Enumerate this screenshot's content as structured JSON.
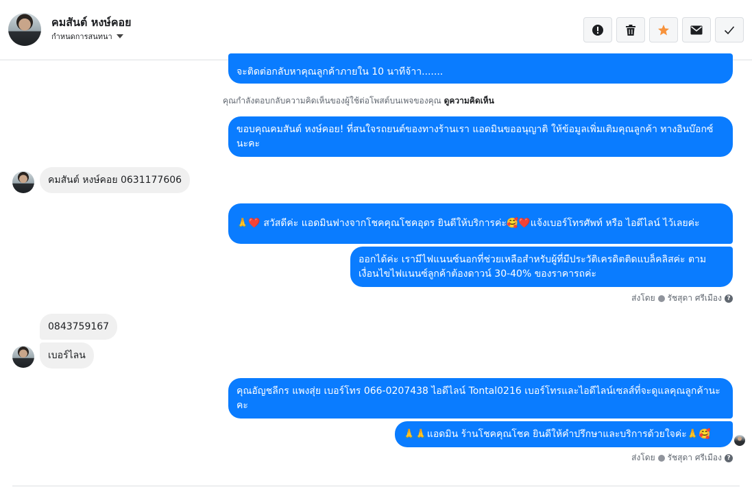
{
  "header": {
    "contact_name": "คมสันต์ หงษ์คอย",
    "assign_label": "กำหนดการสนทนา",
    "actions": {
      "spam": "exclamation-icon",
      "delete": "trash-icon",
      "star": "star-icon",
      "mark_unread": "envelope-icon",
      "done": "check-icon"
    },
    "star_color": "#f7923b"
  },
  "messages": {
    "m1": "จะติดต่อกลับหาคุณลูกค้าภายใน 10 นาทีจ้าา.......",
    "comment_notice": "คุณกำลังตอบกลับความคิดเห็นของผู้ใช้ต่อโพสต์บนเพจของคุณ",
    "comment_link": "ดูความคิดเห็น",
    "m2": "ขอบคุณคมสันต์ หงษ์คอย! ที่สนใจรถยนต์ของทางร้านเรา แอดมินขออนุญาติ ให้ข้อมูลเพิ่มเติมคุณลูกค้า ทางอินบ๊อกซ์นะคะ",
    "m3": "คมสันต์ หงษ์คอย 0631177606",
    "m4": "🙏❤️ สวัสดีค่ะ แอดมินฟางจากโชคคุณโชคอุดร ยินดีให้บริการค่ะ🥰❤️แจ้งเบอร์โทรศัพท์ หรือ ไอดีไลน์  ไว้เลยค่ะ",
    "m5": "ออกได้ค่ะ เรามีไฟแนนซ์นอกที่ช่วยเหลือสำหรับผู้ที่มีประวัติเครดิตติดแบล็คลิสค่ะ ตามเงื่อนไขไฟแนนซ์ลูกค้าต้องดาวน์ 30-40% ของราคารถค่ะ",
    "sent_by_1": "ส่งโดย",
    "sender_1": "รัชสุดา ศรีเมือง",
    "m6": "0843759167",
    "m7": "เบอร์ไลน",
    "m8": "คุณอัญชลีกร แพงสุ่ย      เบอร์โทร 066-0207438 ไอดีไลน์ Tontal0216   เบอร์โทรและไอดีไลน์เซลส์ที่จะดูแลคุณลูกค้านะคะ",
    "m9": "🙏🙏แอดมิน ร้านโชคคุณโชค ยินดีให้คำปรึกษาและบริการด้วยใจค่ะ🙏🥰",
    "sent_by_2": "ส่งโดย",
    "sender_2": "รัชสุดา ศรีเมือง"
  },
  "colors": {
    "outgoing_bubble": "#0a7cff",
    "incoming_bubble": "#f0f0f0"
  }
}
